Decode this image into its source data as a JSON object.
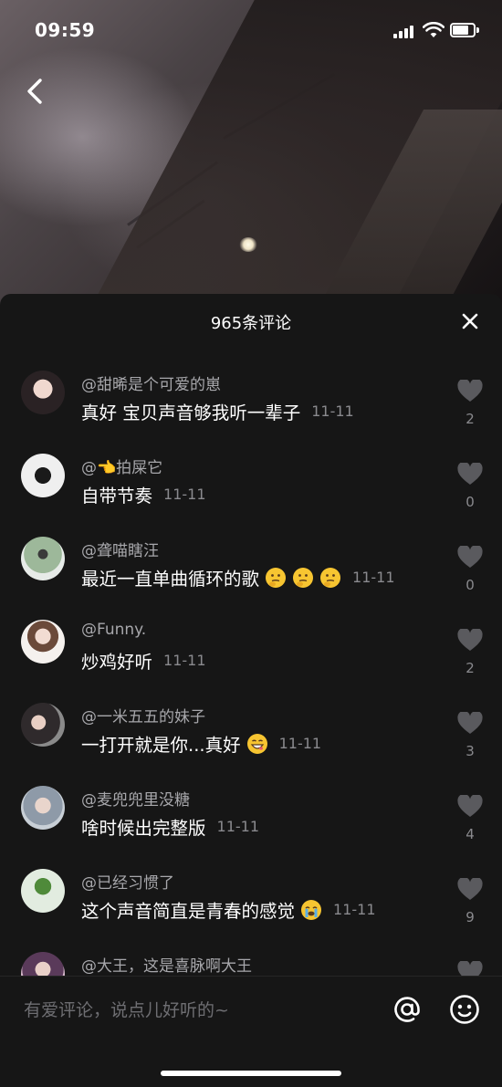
{
  "status_bar": {
    "time": "09:59"
  },
  "navigation": {
    "back_icon": "chevron-left-icon"
  },
  "panel": {
    "title": "965条评论",
    "close_icon": "close-icon"
  },
  "comments": [
    {
      "username": "@甜晞是个可爱的崽",
      "text": "真好 宝贝声音够我听一辈子",
      "emojis": [],
      "date": "11-11",
      "likes": "2"
    },
    {
      "username": "@👈拍屎它",
      "text": "自带节奏",
      "emojis": [],
      "date": "11-11",
      "likes": "0"
    },
    {
      "username": "@聋喵瞎汪",
      "text": "最近一直单曲循环的歌",
      "emojis": [
        "thinking-face",
        "thinking-face",
        "thinking-face"
      ],
      "date": "11-11",
      "likes": "0"
    },
    {
      "username": "@Funny.",
      "text": "炒鸡好听",
      "emojis": [],
      "date": "11-11",
      "likes": "2"
    },
    {
      "username": "@一米五五的妹子",
      "text": "一打开就是你...真好",
      "emojis": [
        "grinning-face"
      ],
      "date": "11-11",
      "likes": "3"
    },
    {
      "username": "@麦兜兜里没糖",
      "text": "啥时候出完整版",
      "emojis": [],
      "date": "11-11",
      "likes": "4"
    },
    {
      "username": "@已经习惯了",
      "text": "这个声音简直是青春的感觉",
      "emojis": [
        "crying-face"
      ],
      "date": "11-11",
      "likes": "9"
    },
    {
      "username": "@大王，这是喜脉啊大王",
      "text": "",
      "emojis": [],
      "date": "",
      "likes": ""
    }
  ],
  "input": {
    "placeholder": "有爱评论，说点儿好听的~",
    "at_icon": "at-icon",
    "emoji_icon": "emoji-icon"
  },
  "colors": {
    "panel_bg": "#161616",
    "username": "#a7a7ab",
    "date": "#8a8a8e",
    "heart": "#5a5a5e"
  }
}
